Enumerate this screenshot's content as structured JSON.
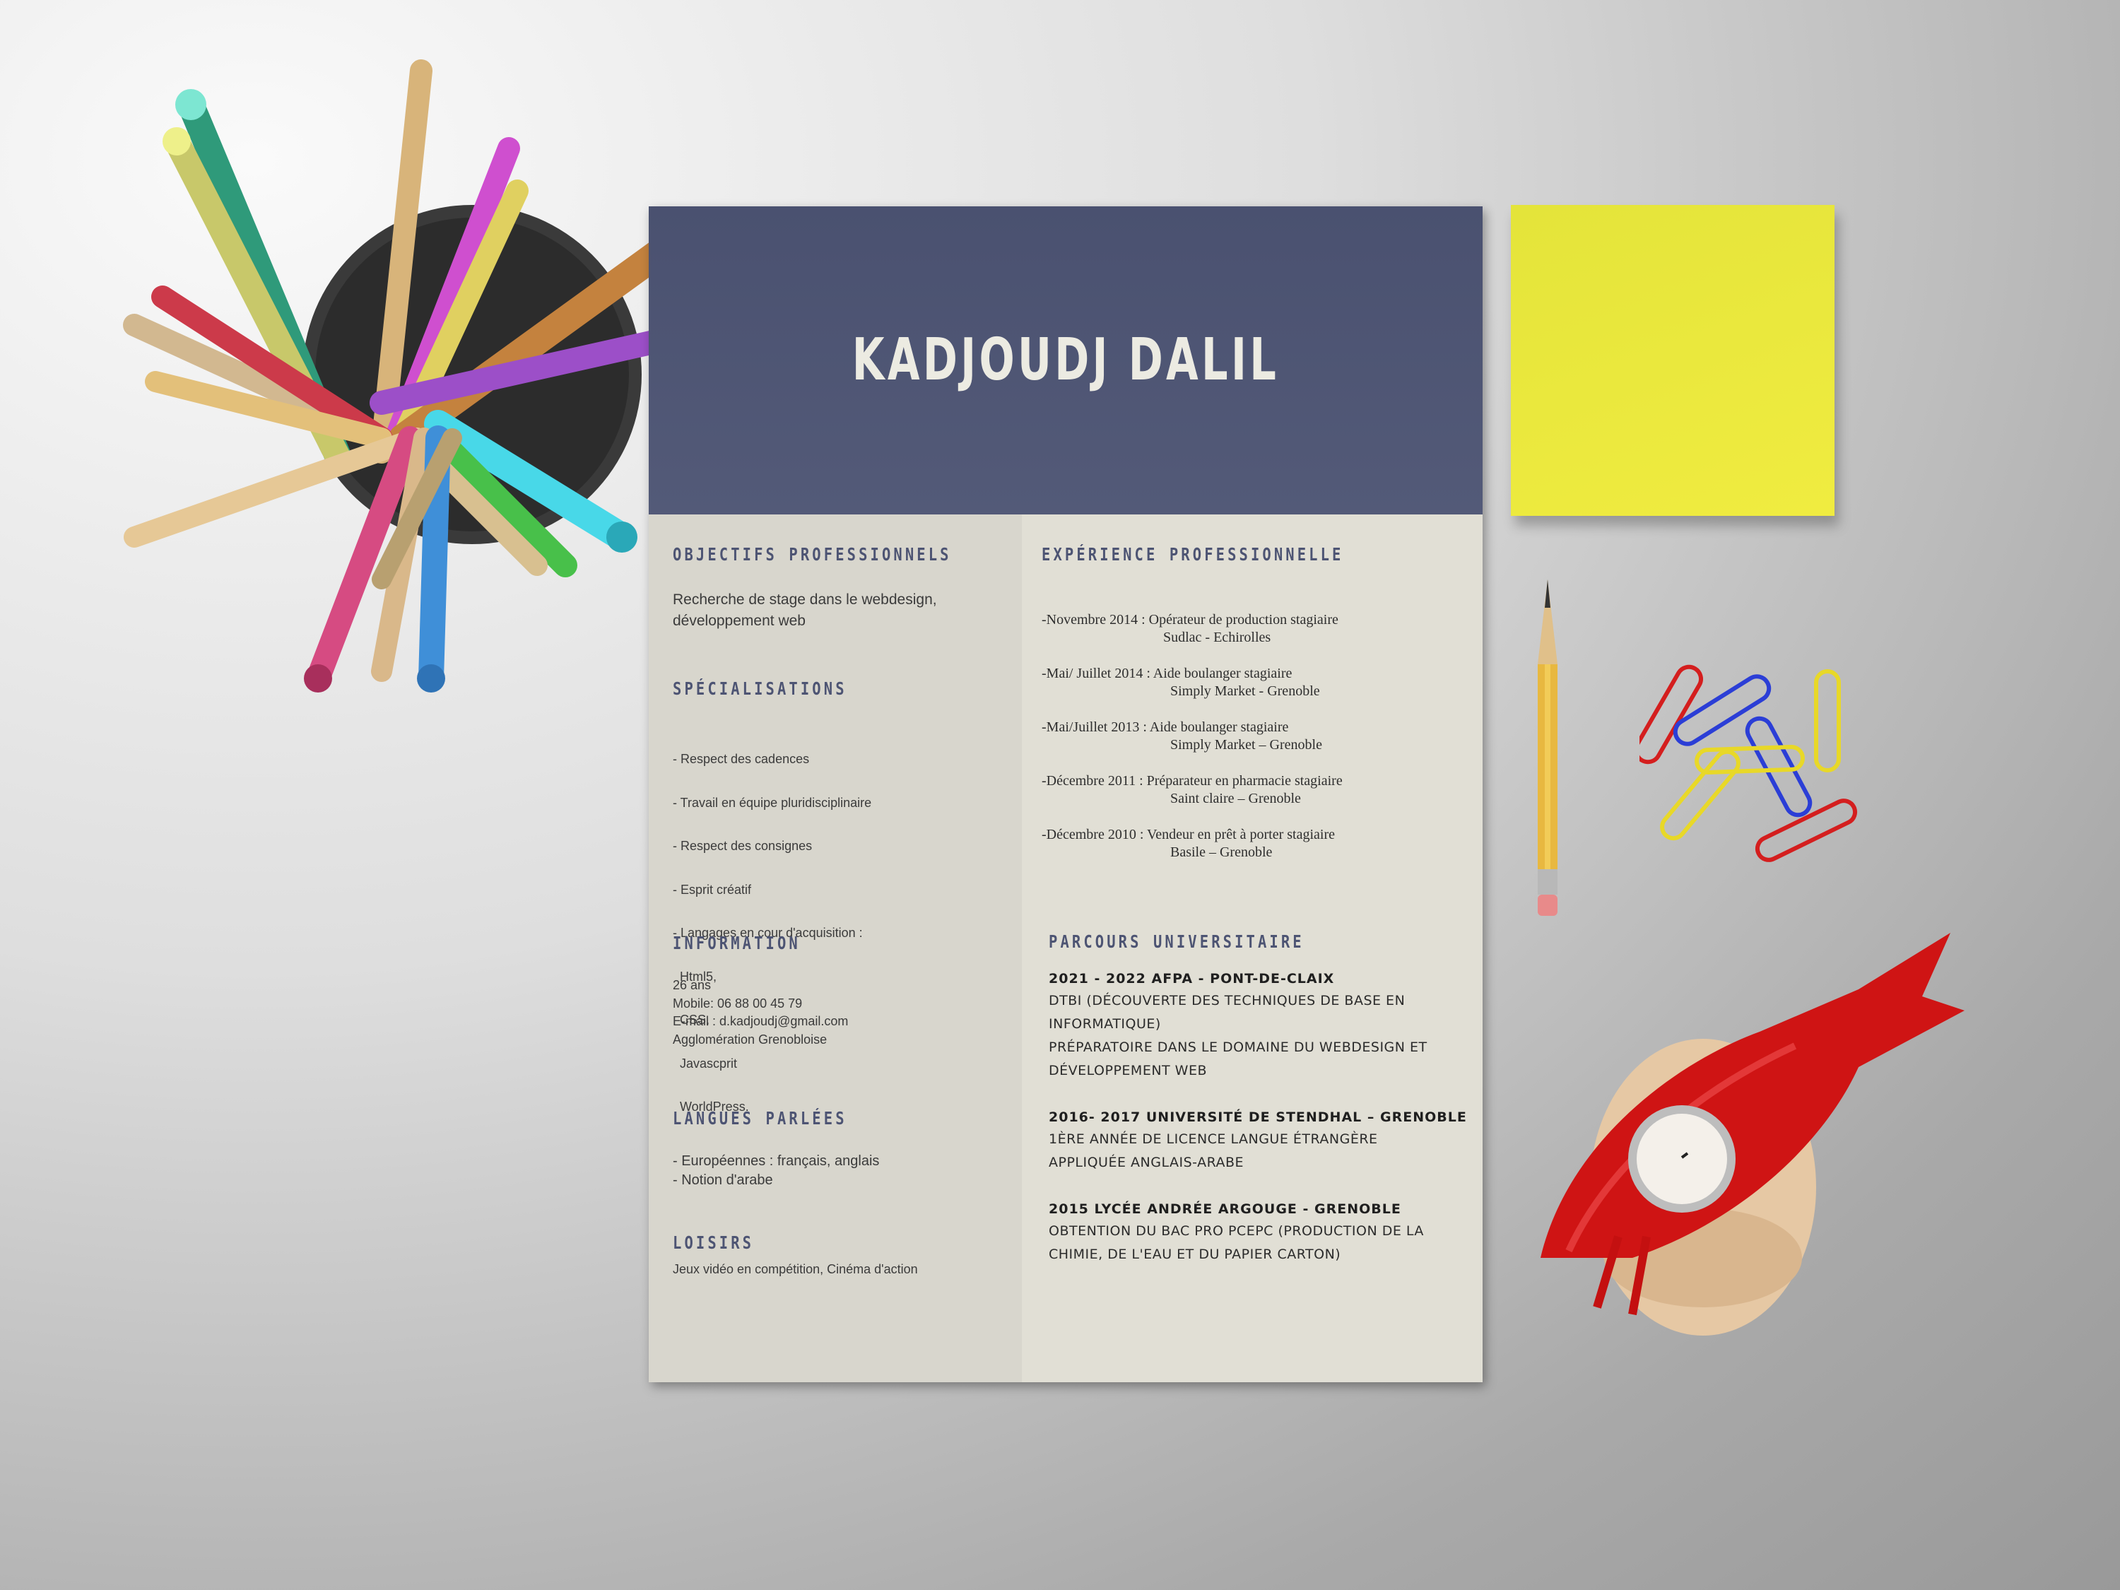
{
  "resume": {
    "name": "KADJOUDJ DALIL",
    "objectifs": {
      "title": "OBJECTIFS PROFESSIONNELS",
      "lines": [
        "Recherche de stage dans le webdesign,",
        "développement web"
      ]
    },
    "specialisations": {
      "title": "SPÉCIALISATIONS",
      "items": [
        "- Respect des cadences",
        "- Travail en équipe pluridisciplinaire",
        "- Respect des consignes",
        "- Esprit créatif",
        "- Langages en cour d'acquisition :",
        "  Html5,",
        "  CSS,",
        "  Javascprit",
        "  WorldPress."
      ]
    },
    "information": {
      "title": "INFORMATION",
      "lines": [
        "26 ans",
        "Mobile: 06 88 00 45 79",
        "E-mail : d.kadjoudj@gmail.com",
        "Agglomération Grenobloise"
      ]
    },
    "langues": {
      "title": "LANGUES PARLÉES",
      "lines": [
        "- Européennes : français, anglais",
        "- Notion d'arabe"
      ]
    },
    "loisirs": {
      "title": "LOISIRS",
      "text": "Jeux vidéo en compétition, Cinéma d'action"
    },
    "experience": {
      "title": "EXPÉRIENCE PROFESSIONNELLE",
      "entries": [
        {
          "line1": "-Novembre 2014 : Opérateur de production stagiaire",
          "line2": "Sudlac - Echirolles"
        },
        {
          "line1": "-Mai/ Juillet 2014 : Aide boulanger stagiaire",
          "line2": "Simply Market - Grenoble"
        },
        {
          "line1": "-Mai/Juillet 2013 :  Aide boulanger stagiaire",
          "line2": "Simply Market – Grenoble"
        },
        {
          "line1": "-Décembre 2011 :  Préparateur en pharmacie stagiaire",
          "line2": "Saint claire – Grenoble"
        },
        {
          "line1": "-Décembre 2010 :  Vendeur en prêt à porter stagiaire",
          "line2": "Basile – Grenoble"
        }
      ]
    },
    "parcours": {
      "title": "PARCOURS UNIVERSITAIRE",
      "entries": [
        {
          "head": "2021 - 2022 AFPA - PONT-DE-CLAIX",
          "lines": [
            "DTBI (DÉCOUVERTE DES TECHNIQUES DE BASE EN",
            "INFORMATIQUE)",
            "PRÉPARATOIRE DANS LE DOMAINE DU WEBDESIGN ET",
            "DÉVELOPPEMENT WEB"
          ]
        },
        {
          "head": "2016- 2017 UNIVERSITÉ DE STENDHAL – GRENOBLE",
          "lines": [
            "1ÈRE ANNÉE DE LICENCE LANGUE ÉTRANGÈRE",
            "APPLIQUÉE ANGLAIS-ARABE"
          ]
        },
        {
          "head": "2015 LYCÉE ANDRÉE ARGOUGE - GRENOBLE",
          "lines": [
            "OBTENTION DU BAC PRO PCEPC (PRODUCTION DE LA",
            "CHIMIE, DE L'EAU ET DU PAPIER CARTON)"
          ]
        }
      ]
    }
  },
  "colors": {
    "header": "#4d5473",
    "paper": "#dcdad0",
    "sticky_note": "#ece83c",
    "bird": "#d41414"
  },
  "icons": [
    "pencil-cup-icon",
    "pencil-icon",
    "paperclips-icon",
    "bird-candle-holder-icon"
  ]
}
